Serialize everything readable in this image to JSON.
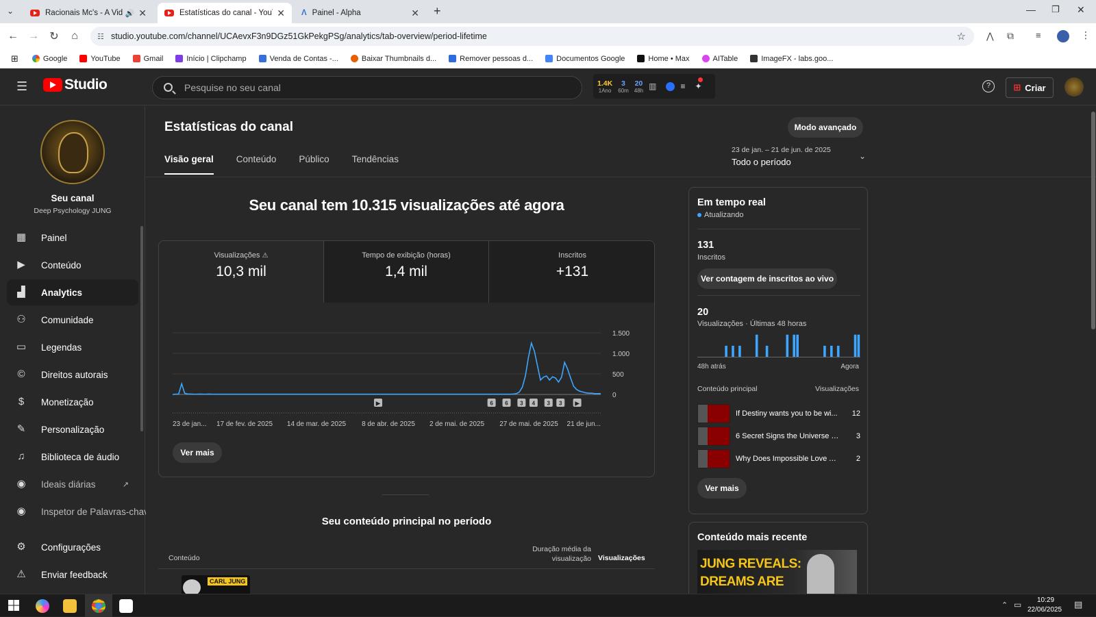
{
  "browser": {
    "tabs": [
      {
        "title": "Racionais Mc's - A Vida é Desafio",
        "active": false
      },
      {
        "title": "Estatísticas do canal - YouTube",
        "active": true
      },
      {
        "title": "Painel - Alpha",
        "active": false
      }
    ],
    "url": "studio.youtube.com/channel/UCAevxF3n9DGz51GkPekgPSg/analytics/tab-overview/period-lifetime",
    "bookmarks": [
      "Google",
      "YouTube",
      "Gmail",
      "Início | Clipchamp",
      "Venda de Contas -...",
      "Baixar Thumbnails d...",
      "Remover pessoas d...",
      "Documentos Google",
      "Home • Max",
      "AITable",
      "ImageFX - labs.goo..."
    ]
  },
  "header": {
    "logo_text": "Studio",
    "search_placeholder": "Pesquise no seu canal",
    "ext": {
      "a_val": "1.4K",
      "a_sub": "1Ano",
      "b_val": "3",
      "b_sub": "60m",
      "c_val": "20",
      "c_sub": "48h"
    },
    "create_label": "Criar"
  },
  "sidebar": {
    "channel_label": "Seu canal",
    "channel_name": "Deep Psychology JUNG",
    "items": [
      {
        "label": "Painel",
        "icon": "dashboard-icon"
      },
      {
        "label": "Conteúdo",
        "icon": "content-icon"
      },
      {
        "label": "Analytics",
        "icon": "analytics-icon",
        "active": true
      },
      {
        "label": "Comunidade",
        "icon": "community-icon"
      },
      {
        "label": "Legendas",
        "icon": "subtitles-icon"
      },
      {
        "label": "Direitos autorais",
        "icon": "copyright-icon"
      },
      {
        "label": "Monetização",
        "icon": "dollar-icon"
      },
      {
        "label": "Personalização",
        "icon": "magic-wand-icon"
      },
      {
        "label": "Biblioteca de áudio",
        "icon": "audio-library-icon"
      },
      {
        "label": "Ideais diárias",
        "icon": "extension-icon"
      },
      {
        "label": "Inspetor de Palavras-chav",
        "icon": "extension-icon"
      }
    ],
    "settings_label": "Configurações",
    "feedback_label": "Enviar feedback"
  },
  "main": {
    "title": "Estatísticas do canal",
    "advanced_label": "Modo avançado",
    "tabs": [
      "Visão geral",
      "Conteúdo",
      "Público",
      "Tendências"
    ],
    "period_range": "23 de jan. – 21 de jun. de 2025",
    "period_label": "Todo o período",
    "headline": "Seu canal tem 10.315 visualizações até agora",
    "metrics": [
      {
        "label": "Visualizações",
        "value": "10,3 mil"
      },
      {
        "label": "Tempo de exibição (horas)",
        "value": "1,4 mil"
      },
      {
        "label": "Inscritos",
        "value": "+131"
      }
    ],
    "see_more": "Ver mais",
    "top_content_title": "Seu conteúdo principal no período",
    "table_headers": {
      "content": "Conteúdo",
      "duration": "Duração média da visualização",
      "views": "Visualizações"
    },
    "top_thumb_label": "CARL JUNG"
  },
  "chart_data": {
    "type": "line",
    "x_ticks": [
      "23 de jan...",
      "17 de fev. de 2025",
      "14 de mar. de 2025",
      "8 de abr. de 2025",
      "2 de mai. de 2025",
      "27 de mai. de 2025",
      "21 de jun..."
    ],
    "y_ticks": [
      "1.500",
      "1.000",
      "500",
      "0"
    ],
    "ylim": [
      0,
      1500
    ],
    "series": [
      {
        "values": [
          0,
          5,
          10,
          260,
          30,
          10,
          10,
          5,
          5,
          10,
          5,
          5,
          10,
          5,
          5,
          5,
          5,
          5,
          5,
          5,
          5,
          5,
          5,
          5,
          5,
          5,
          5,
          5,
          5,
          5,
          5,
          5,
          5,
          5,
          5,
          5,
          5,
          5,
          5,
          5,
          5,
          5,
          5,
          5,
          5,
          5,
          5,
          5,
          5,
          5,
          5,
          5,
          5,
          5,
          5,
          5,
          5,
          5,
          5,
          5,
          5,
          5,
          5,
          5,
          5,
          5,
          5,
          5,
          5,
          5,
          5,
          5,
          5,
          5,
          5,
          5,
          5,
          5,
          5,
          5,
          5,
          5,
          5,
          5,
          5,
          5,
          5,
          5,
          5,
          5,
          5,
          5,
          5,
          5,
          5,
          5,
          5,
          5,
          5,
          5,
          5,
          5,
          5,
          5,
          5,
          5,
          5,
          5,
          5,
          5,
          5,
          5,
          5,
          10,
          20,
          60,
          180,
          450,
          900,
          1250,
          1050,
          700,
          350,
          420,
          450,
          350,
          430,
          400,
          300,
          420,
          780,
          620,
          400,
          200,
          120,
          80,
          60,
          40,
          30,
          30,
          20,
          20,
          20
        ]
      }
    ],
    "markers": [
      {
        "label": "▶",
        "pos": 0.48
      },
      {
        "label": "6",
        "pos": 0.745
      },
      {
        "label": "6",
        "pos": 0.78
      },
      {
        "label": "3",
        "pos": 0.815
      },
      {
        "label": "4",
        "pos": 0.843
      },
      {
        "label": "3",
        "pos": 0.878
      },
      {
        "label": "3",
        "pos": 0.906
      },
      {
        "label": "▶",
        "pos": 0.945
      }
    ]
  },
  "realtime": {
    "title": "Em tempo real",
    "status": "Atualizando",
    "subs_value": "131",
    "subs_label": "Inscritos",
    "live_button": "Ver contagem de inscritos ao vivo",
    "views_value": "20",
    "views_label": "Visualizações · Últimas 48 horas",
    "bar_values": [
      0,
      0,
      0,
      0,
      0,
      0,
      0,
      0,
      1,
      0,
      1,
      0,
      1,
      0,
      0,
      0,
      0,
      2,
      0,
      0,
      1,
      0,
      0,
      0,
      0,
      0,
      2,
      0,
      2,
      2,
      0,
      0,
      0,
      0,
      0,
      0,
      0,
      1,
      0,
      1,
      0,
      1,
      0,
      0,
      0,
      0,
      2,
      2
    ],
    "left_label": "48h atrás",
    "right_label": "Agora",
    "content_header": "Conteúdo principal",
    "views_header": "Visualizações",
    "videos": [
      {
        "title": "If Destiny wants you to be wi...",
        "views": "12"
      },
      {
        "title": "6 Secret Signs the Universe W...",
        "views": "3"
      },
      {
        "title": "Why Does Impossible Love Af...",
        "views": "2"
      }
    ],
    "see_more": "Ver mais"
  },
  "recent": {
    "title": "Conteúdo mais recente",
    "thumb_line1": "JUNG REVEALS:",
    "thumb_line2": "DREAMS ARE"
  },
  "taskbar": {
    "time": "10:29",
    "date": "22/06/2025"
  },
  "colors": {
    "accent": "#3ea6ff",
    "chart_line": "#3ea6ff",
    "brand": "#ff0000"
  }
}
